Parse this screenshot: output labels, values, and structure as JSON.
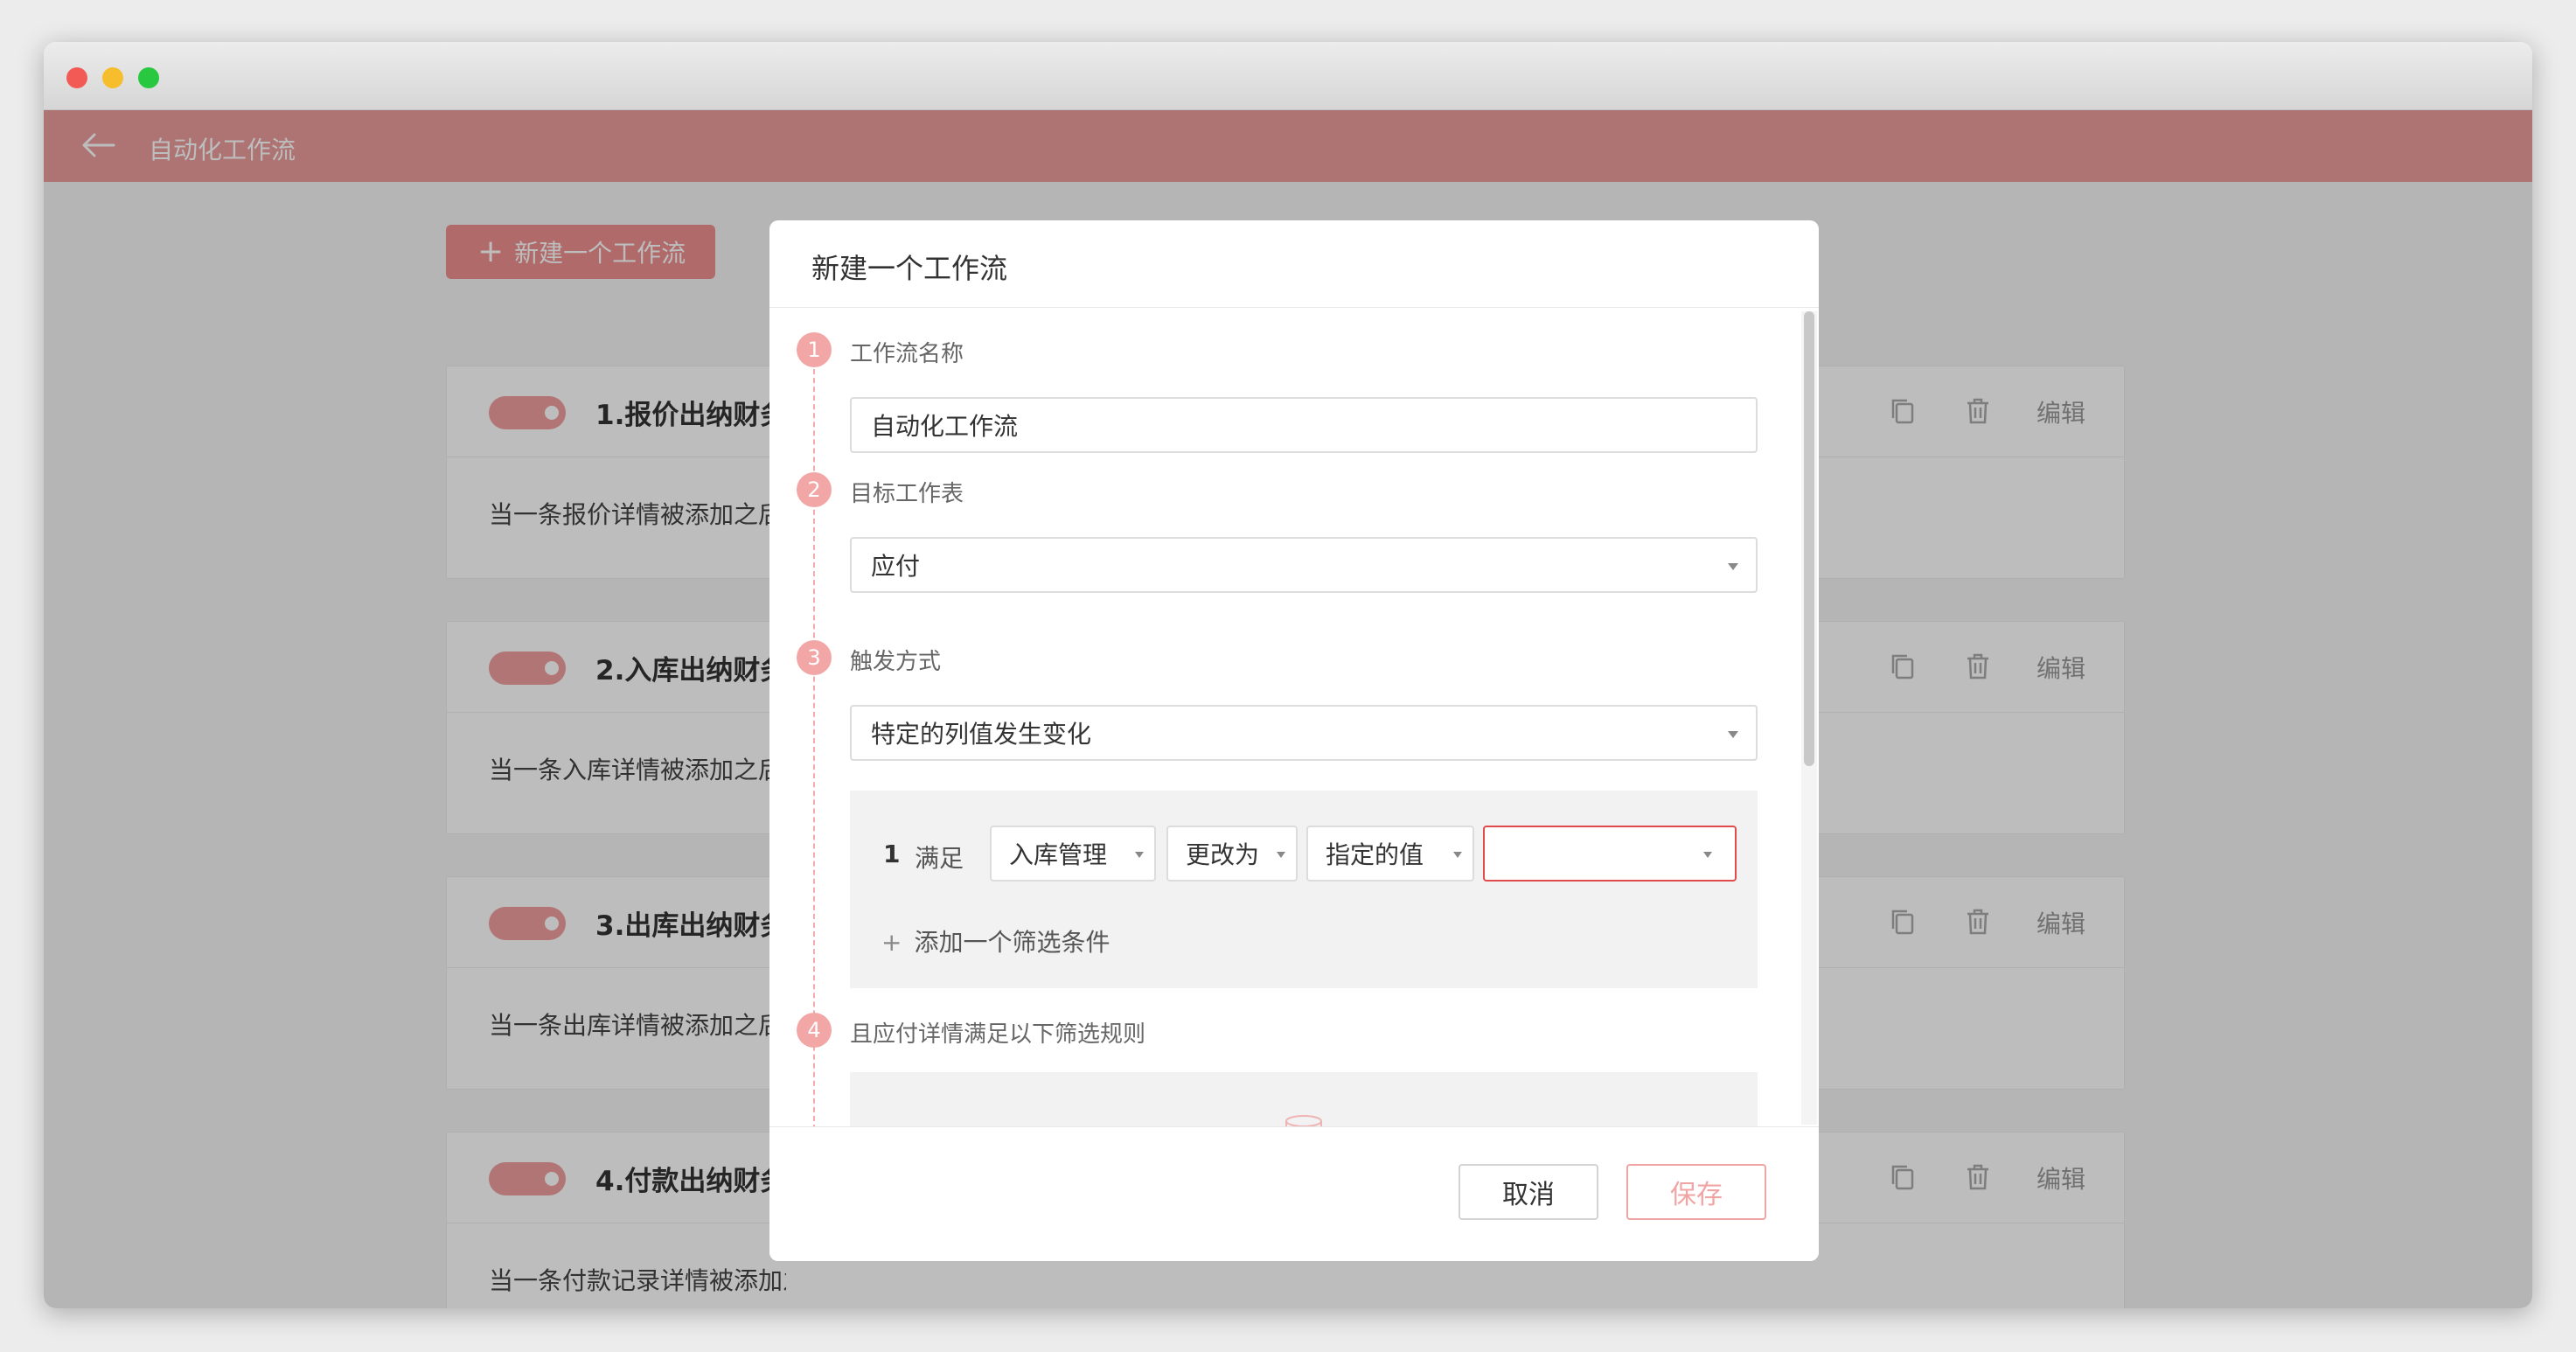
{
  "window": {
    "title_buttons": [
      "close",
      "minimize",
      "zoom"
    ]
  },
  "appbar": {
    "back_icon": "arrow-left-icon",
    "title": "自动化工作流",
    "color": "#eb9b9b"
  },
  "page": {
    "new_button_label": "新建一个工作流"
  },
  "workflows": [
    {
      "title": "1.报价出纳财务",
      "description": "当一条报价详情被添加之后",
      "enabled": true,
      "edit_label": "编辑"
    },
    {
      "title": "2.入库出纳财务",
      "description": "当一条入库详情被添加之后",
      "enabled": true,
      "edit_label": "编辑"
    },
    {
      "title": "3.出库出纳财务",
      "description": "当一条出库详情被添加之后",
      "enabled": true,
      "edit_label": "编辑"
    },
    {
      "title": "4.付款出纳财务",
      "description": "当一条付款记录详情被添加之后",
      "enabled": true,
      "edit_label": "编辑"
    }
  ],
  "modal": {
    "title": "新建一个工作流",
    "steps": [
      {
        "number": "1",
        "label": "工作流名称",
        "value": "自动化工作流"
      },
      {
        "number": "2",
        "label": "目标工作表",
        "value": "应付"
      },
      {
        "number": "3",
        "label": "触发方式",
        "value": "特定的列值发生变化"
      },
      {
        "number": "4",
        "label": "且应付详情满足以下筛选规则"
      }
    ],
    "condition": {
      "index": "1",
      "word": "满足",
      "field": "入库管理",
      "operator": "更改为",
      "value_type": "指定的值",
      "value": ""
    },
    "add_filter_label": "添加一个筛选条件",
    "cancel_label": "取消",
    "save_label": "保存"
  },
  "colors": {
    "accent": "#ee8f8f",
    "error_border": "#e24b4b"
  }
}
